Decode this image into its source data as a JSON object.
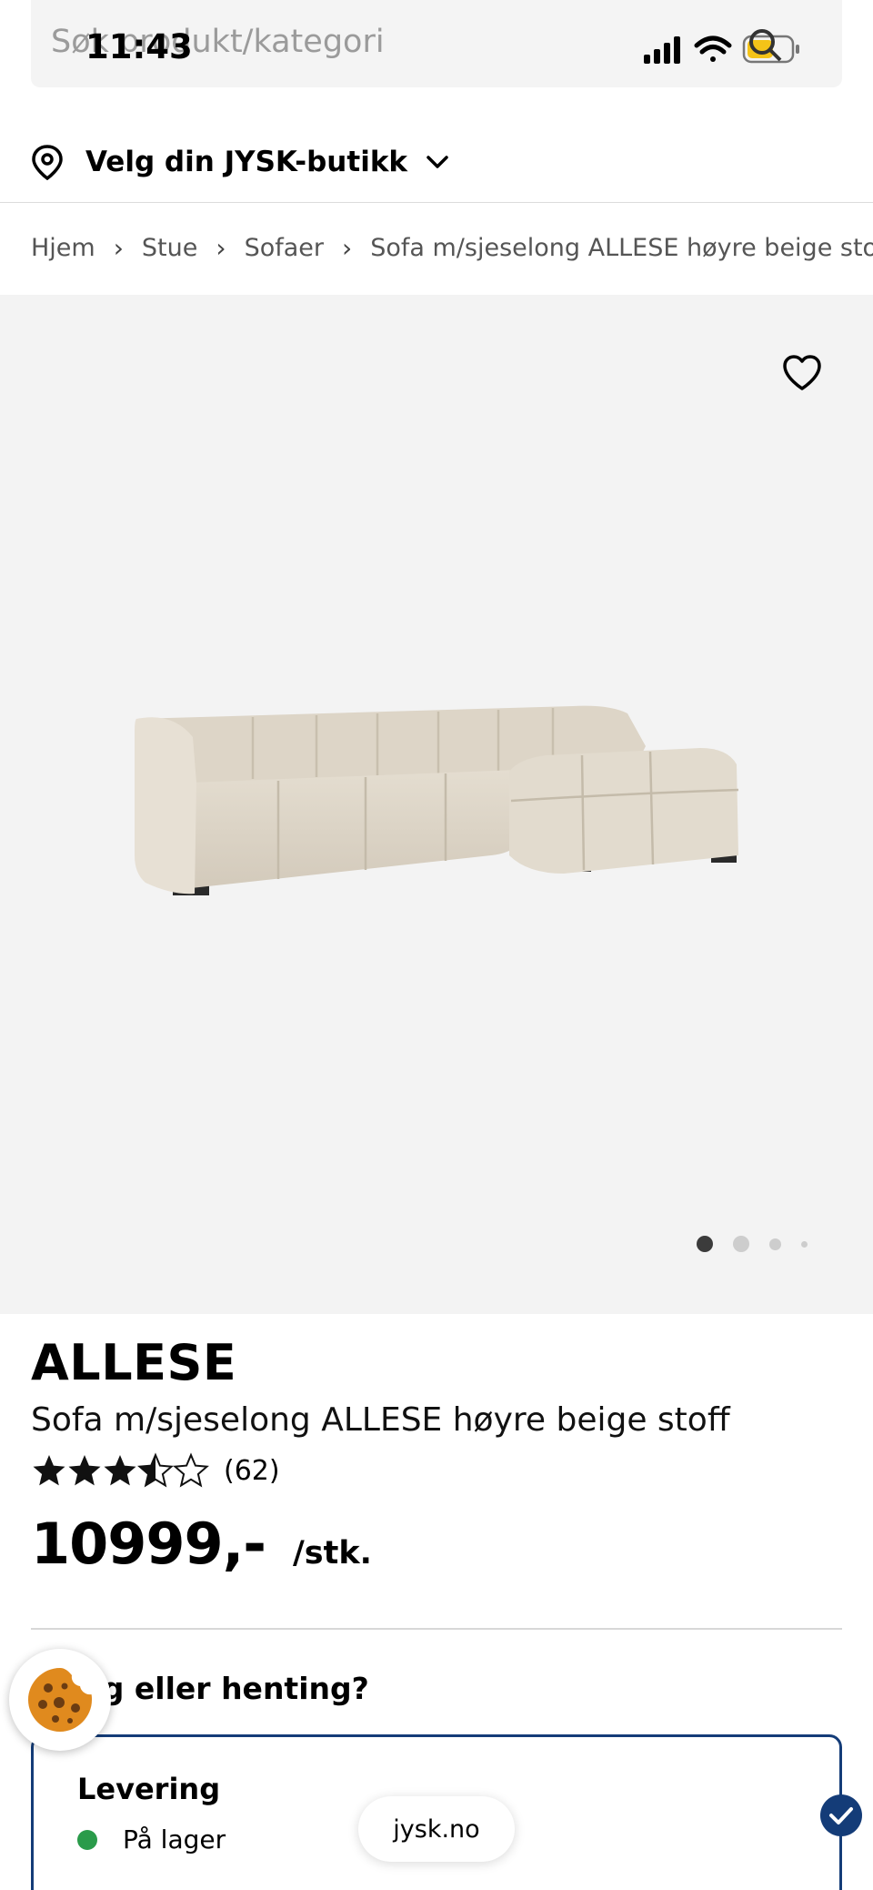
{
  "search": {
    "placeholder": "Søk produkt/kategori"
  },
  "status_bar": {
    "time": "11:43"
  },
  "store": {
    "label": "Velg din JYSK-butikk"
  },
  "breadcrumb": [
    "Hjem",
    "Stue",
    "Sofaer",
    "Sofa m/sjeselong ALLESE høyre beige stoff"
  ],
  "gallery": {
    "image_count": 4,
    "active_index": 0
  },
  "product": {
    "brand": "ALLESE",
    "name": "Sofa m/sjeselong ALLESE høyre beige stoff",
    "rating": 3.5,
    "rating_max": 5,
    "review_count": "(62)",
    "price": "10999,-",
    "unit": "/stk."
  },
  "delivery": {
    "heading": "ing eller henting?",
    "option_title": "Levering",
    "stock_status": "På lager",
    "selected": true
  },
  "browser": {
    "url": "jysk.no"
  },
  "colors": {
    "accent": "#143c78",
    "in_stock": "#2a9b4a",
    "image_bg": "#f3f3f3"
  }
}
